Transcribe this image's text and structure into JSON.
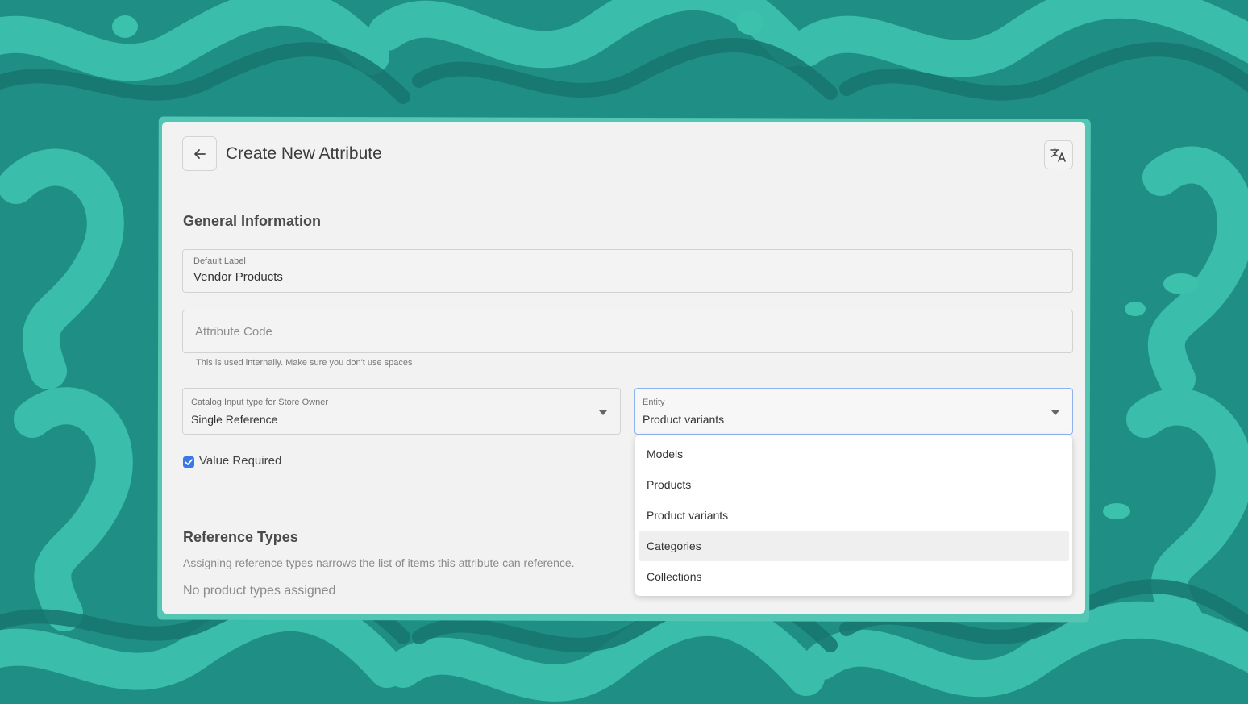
{
  "header": {
    "title": "Create New Attribute",
    "back_icon": "arrow-left-icon",
    "translate_icon": "translate-icon"
  },
  "general": {
    "section_title": "General Information",
    "default_label": {
      "label": "Default Label",
      "value": "Vendor Products"
    },
    "attribute_code": {
      "placeholder": "Attribute Code",
      "value": "",
      "helper": "This is used internally. Make sure you don't use spaces"
    },
    "input_type": {
      "label": "Catalog Input type for Store Owner",
      "value": "Single Reference"
    },
    "entity": {
      "label": "Entity",
      "value": "Product variants",
      "options": [
        "Models",
        "Products",
        "Product variants",
        "Categories",
        "Collections"
      ],
      "highlighted": "Categories"
    },
    "value_required": {
      "label": "Value Required",
      "checked": true
    }
  },
  "reference": {
    "section_title": "Reference Types",
    "description": "Assigning reference types narrows the list of items this attribute can reference.",
    "empty": "No product types assigned"
  },
  "colors": {
    "background": "#1f8f86",
    "wave_light": "#3cc1ad",
    "wave_dark": "#16766f",
    "accent": "#3b78e7"
  }
}
